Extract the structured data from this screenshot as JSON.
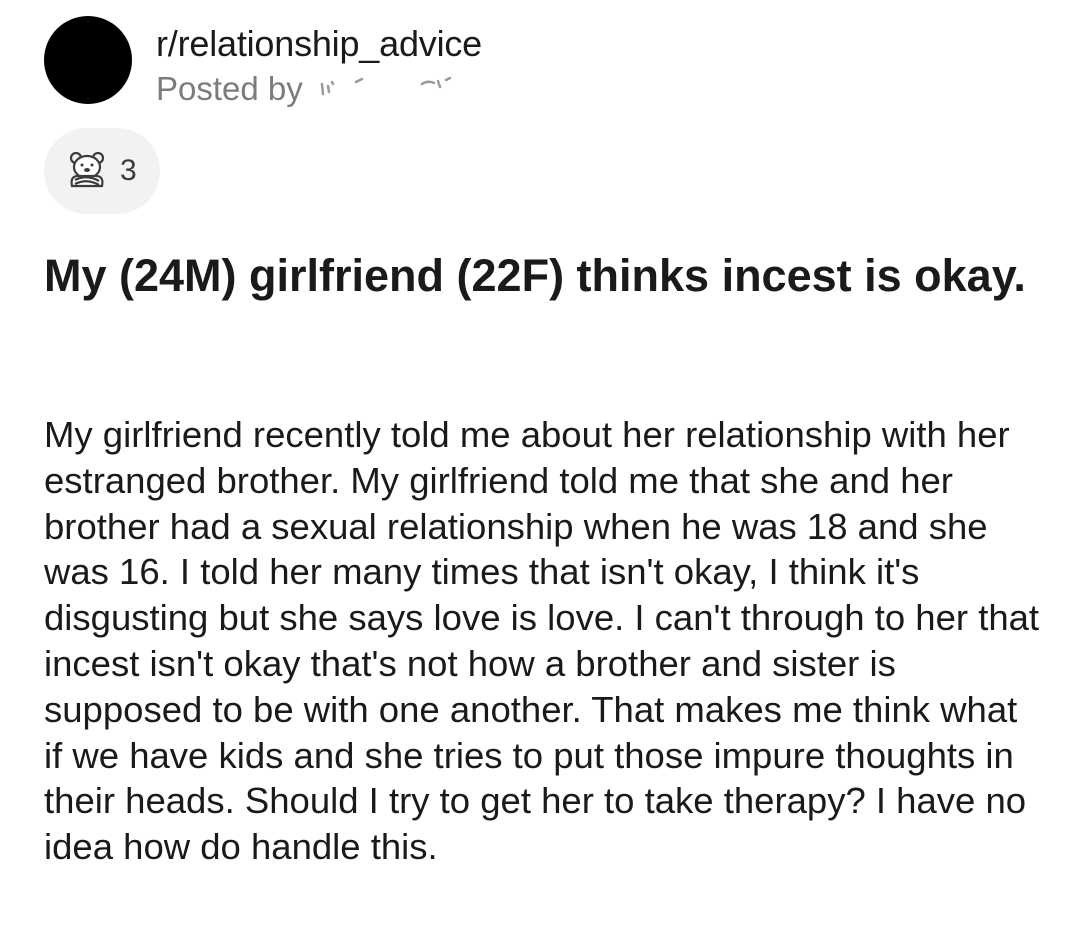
{
  "post": {
    "subreddit": "r/relationship_advice",
    "posted_by_label": "Posted by",
    "award": {
      "icon": "bear-award-icon",
      "count": "3"
    },
    "title": "My (24M) girlfriend (22F) thinks incest is okay.",
    "body": "My girlfriend recently told me about her relationship with her estranged brother. My girlfriend told me that she and her brother had a sexual relationship when he was 18 and she was 16. I told her many times that isn't okay, I think it's disgusting but she says love is love. I can't through to her that incest isn't okay that's not how a brother and sister is supposed to be with one another. That makes me think what if we have kids and she tries to put those impure thoughts in their heads. Should I try to get her to take therapy? I have no idea how do handle this."
  },
  "colors": {
    "text": "#1a1a1b",
    "meta": "#7c7c7c",
    "chip_bg": "#f1f2f4",
    "avatar": "#000000"
  }
}
